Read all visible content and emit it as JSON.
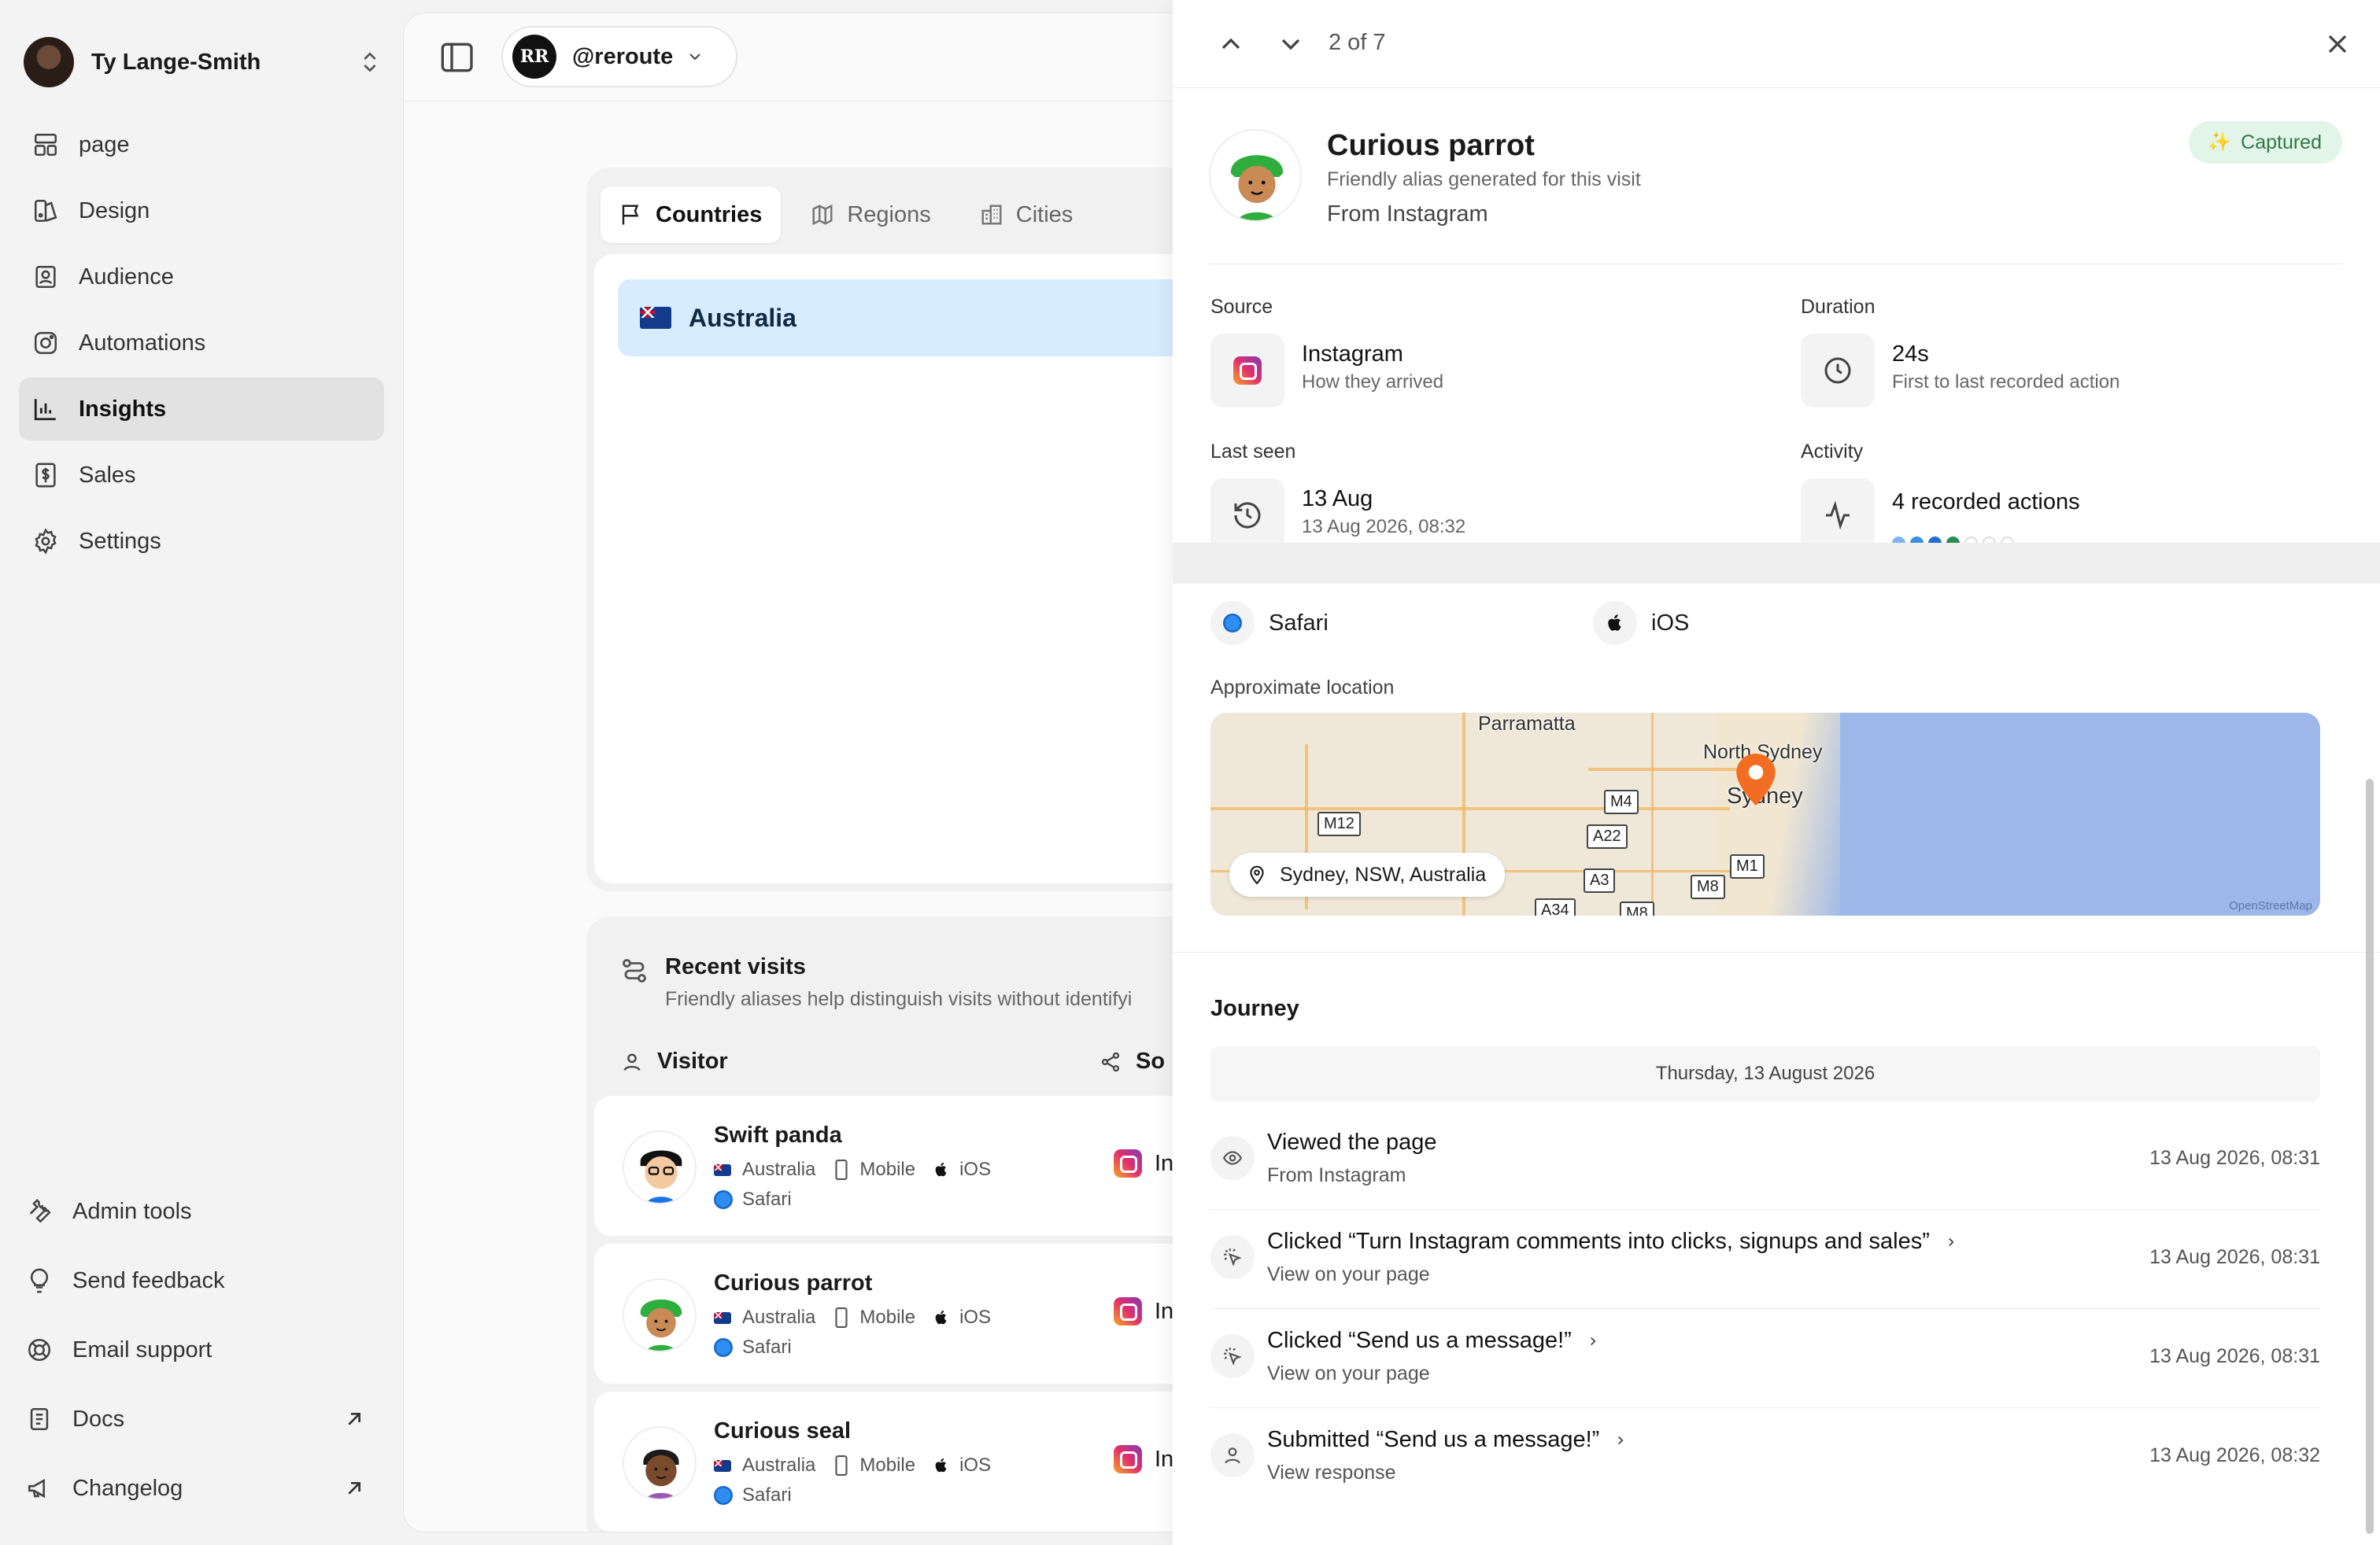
{
  "sidebar": {
    "user_name": "Ty Lange-Smith",
    "nav": [
      {
        "label": "page",
        "icon": "layout-icon"
      },
      {
        "label": "Design",
        "icon": "palette-icon"
      },
      {
        "label": "Audience",
        "icon": "contact-icon"
      },
      {
        "label": "Automations",
        "icon": "instagram-icon"
      },
      {
        "label": "Insights",
        "icon": "bar-chart-icon",
        "active": true
      },
      {
        "label": "Sales",
        "icon": "dollar-receipt-icon"
      },
      {
        "label": "Settings",
        "icon": "gear-icon"
      }
    ],
    "footer": [
      {
        "label": "Admin tools",
        "icon": "wrench-icon"
      },
      {
        "label": "Send feedback",
        "icon": "lightbulb-icon"
      },
      {
        "label": "Email support",
        "icon": "lifebuoy-icon"
      },
      {
        "label": "Docs",
        "icon": "document-icon",
        "external": true
      },
      {
        "label": "Changelog",
        "icon": "megaphone-icon",
        "external": true
      }
    ]
  },
  "main": {
    "account_handle": "@reroute",
    "account_logo_text": "RR",
    "geo_tabs": [
      "Countries",
      "Regions",
      "Cities"
    ],
    "selected_country": "Australia",
    "recent_visits": {
      "title": "Recent visits",
      "subtitle": "Friendly aliases help distinguish visits without identifyi",
      "col_visitor": "Visitor",
      "col_source": "So",
      "rows": [
        {
          "name": "Swift panda",
          "country": "Australia",
          "device": "Mobile",
          "os": "iOS",
          "browser": "Safari",
          "source": "In"
        },
        {
          "name": "Curious parrot",
          "country": "Australia",
          "device": "Mobile",
          "os": "iOS",
          "browser": "Safari",
          "source": "In"
        },
        {
          "name": "Curious seal",
          "country": "Australia",
          "device": "Mobile",
          "os": "iOS",
          "browser": "Safari",
          "source": "In"
        }
      ]
    }
  },
  "drawer": {
    "counter": "2 of 7",
    "alias": "Curious parrot",
    "alias_sub": "Friendly alias generated for this visit",
    "from": "From Instagram",
    "badge": "Captured",
    "source": {
      "label": "Source",
      "value": "Instagram",
      "sub": "How they arrived"
    },
    "duration": {
      "label": "Duration",
      "value": "24s",
      "sub": "First to last recorded action"
    },
    "last_seen": {
      "label": "Last seen",
      "value": "13 Aug",
      "sub": "13 Aug 2026, 08:32"
    },
    "activity": {
      "label": "Activity",
      "value": "4 recorded actions",
      "dot_colors": [
        "#7fb6f2",
        "#3d8fe0",
        "#1f6fc9",
        "#2e8b57",
        "#ffffff",
        "#ffffff",
        "#ffffff"
      ]
    },
    "browser": "Safari",
    "os": "iOS",
    "location_label": "Approximate location",
    "location": "Sydney, NSW, Australia",
    "map": {
      "places": [
        "Parramatta",
        "North Sydney",
        "Sydney"
      ],
      "shields": [
        "M12",
        "M4",
        "A22",
        "A3",
        "M8",
        "M1",
        "A34",
        "M8"
      ],
      "attribution": "OpenStreetMap"
    },
    "journey_title": "Journey",
    "journey_date": "Thursday, 13 August 2026",
    "events": [
      {
        "title": "Viewed the page",
        "sub": "From Instagram",
        "time": "13 Aug 2026, 08:31",
        "icon": "eye-icon",
        "chevron": false
      },
      {
        "title": "Clicked “Turn Instagram comments into clicks, signups and sales”",
        "sub": "View on your page",
        "time": "13 Aug 2026, 08:31",
        "icon": "click-icon",
        "chevron": true
      },
      {
        "title": "Clicked “Send us a message!”",
        "sub": "View on your page",
        "time": "13 Aug 2026, 08:31",
        "icon": "click-icon",
        "chevron": true
      },
      {
        "title": "Submitted “Send us a message!”",
        "sub": "View response",
        "time": "13 Aug 2026, 08:32",
        "icon": "user-icon",
        "chevron": true
      }
    ]
  }
}
